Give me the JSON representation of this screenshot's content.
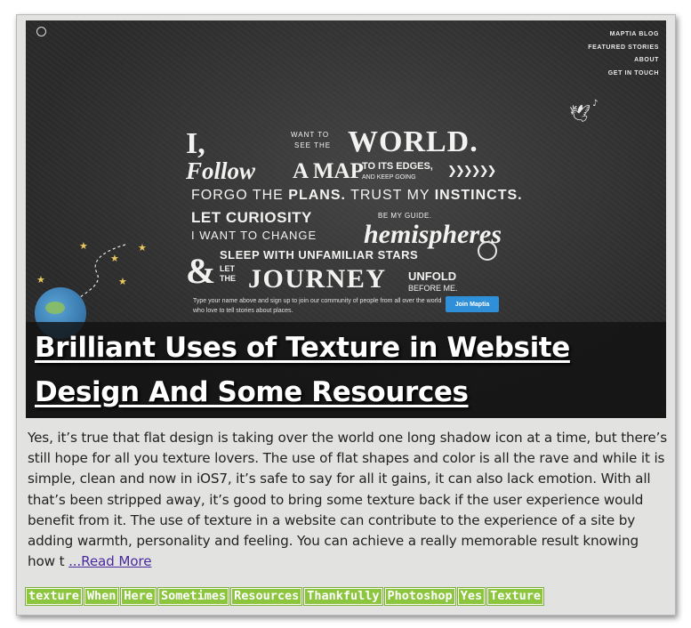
{
  "hero": {
    "nav": [
      "MAPTIA BLOG",
      "FEATURED STORIES",
      "ABOUT",
      "GET IN TOUCH"
    ],
    "lettering": {
      "i": "I,",
      "want_to": "WANT TO",
      "see_the": "SEE THE",
      "world": "WORLD.",
      "follow": "Follow",
      "a_map": "A MAP",
      "to_its_edges": "TO ITS EDGES,",
      "and_keep_going": "AND KEEP GOING",
      "forgo": "FORGO THE ",
      "plans": "PLANS.",
      "trust": " TRUST MY ",
      "instincts": "INSTINCTS.",
      "let_curiosity": "LET CURIOSITY",
      "be_my_guide": "BE MY GUIDE.",
      "i_want_to_change": "I WANT TO CHANGE",
      "hemispheres": "hemispheres",
      "sleep": "SLEEP WITH UNFAMILIAR STARS",
      "ampersand": "&",
      "let": "LET",
      "the": "THE",
      "journey": "JOURNEY",
      "unfold": "UNFOLD",
      "before_me": "BEFORE ME."
    },
    "signup_text": "Type your name above and sign up to join our community of people from all over the world who love to tell stories about places.",
    "join_button": "Join Maptia"
  },
  "post": {
    "title": "Brilliant Uses of Texture in Website Design And Some Resources",
    "excerpt": "Yes, it’s true that flat design is taking over the world one long shadow icon at a time, but there’s still hope for all you texture lovers. The use of flat shapes and color is all the rave and while it is simple, clean and now in iOS7, it’s safe to say for all it gains, it can also lack emotion. With all that’s been stripped away, it’s good to bring some texture back if the user experience would benefit from it. The use of texture in a website can contribute to the experience of a site by adding warmth, personality and feeling. You can achieve a really memorable result knowing how t ",
    "read_more": "...Read More",
    "tags": [
      "texture",
      "When",
      "Here",
      "Sometimes",
      "Resources",
      "Thankfully",
      "Photoshop",
      "Yes",
      "Texture"
    ]
  },
  "colors": {
    "card_bg": "#e2e2e0",
    "hero_bg": "#2b2b2b",
    "tag_bg": "#8cc63e",
    "link": "#4b2aa0",
    "join_button": "#2f8fd8"
  }
}
